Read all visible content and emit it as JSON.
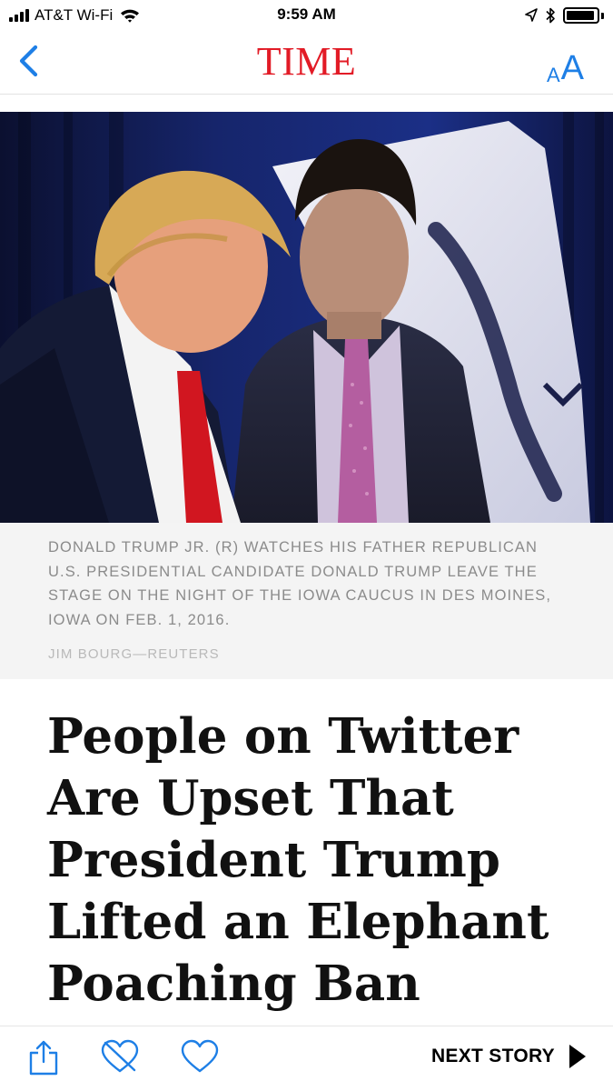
{
  "status_bar": {
    "carrier": "AT&T Wi-Fi",
    "time": "9:59 AM",
    "battery_level": 0.95
  },
  "nav": {
    "logo": "TIME",
    "text_size_small": "A",
    "text_size_large": "A"
  },
  "article": {
    "image_caption": "DONALD TRUMP JR. (R) WATCHES HIS FATHER REPUBLICAN U.S. PRESIDENTIAL CANDIDATE DONALD TRUMP LEAVE THE STAGE ON THE NIGHT OF THE IOWA CAUCUS IN DES MOINES, IOWA ON FEB. 1, 2016.",
    "image_credit": "JIM BOURG—REUTERS",
    "headline": "People on Twitter Are Upset That President Trump Lifted an Elephant Poaching Ban"
  },
  "toolbar": {
    "next_story_label": "NEXT STORY"
  },
  "icons": [
    "signal-icon",
    "wifi-icon",
    "location-icon",
    "bluetooth-icon",
    "battery-icon",
    "back-chevron-icon",
    "text-size-icon",
    "share-icon",
    "dislike-heart-icon",
    "heart-icon",
    "play-arrow-icon"
  ],
  "colors": {
    "accent_blue": "#1e7fe6",
    "logo_red": "#e21b26",
    "caption_text": "#8b8b8b",
    "caption_bg": "#f4f4f4"
  }
}
